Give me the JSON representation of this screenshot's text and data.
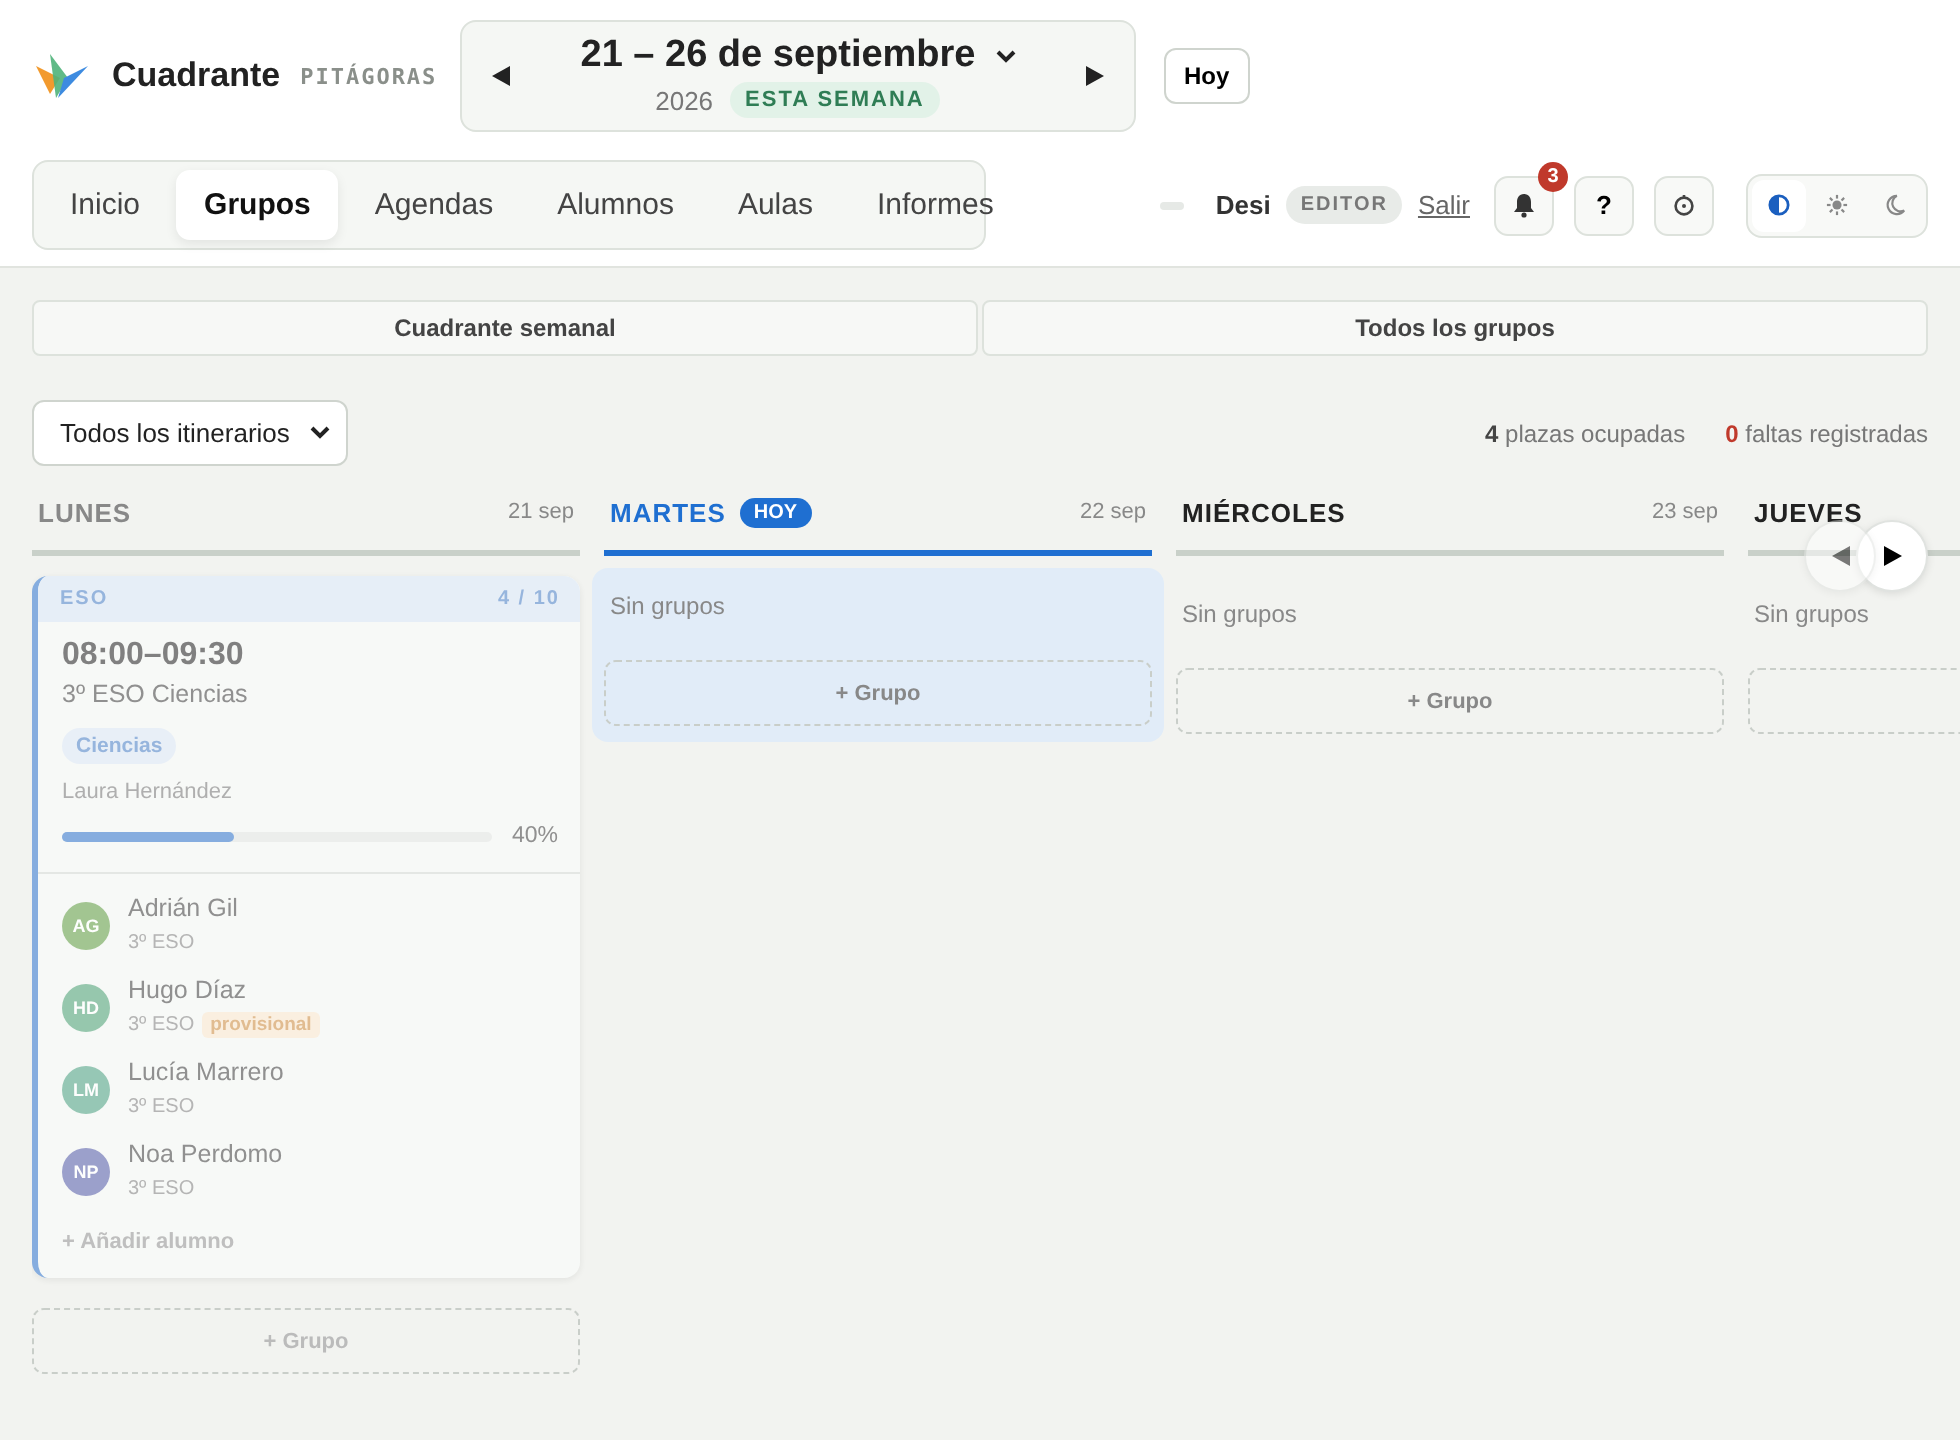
{
  "brand": {
    "name": "Cuadrante",
    "subtitle": "PITÁGORAS"
  },
  "week": {
    "range": "21 – 26 de septiembre",
    "year": "2026",
    "badge": "ESTA SEMANA"
  },
  "today_button": "Hoy",
  "nav_tabs": [
    {
      "label": "Inicio",
      "selected": false
    },
    {
      "label": "Grupos",
      "selected": true
    },
    {
      "label": "Agendas",
      "selected": false
    },
    {
      "label": "Alumnos",
      "selected": false
    },
    {
      "label": "Aulas",
      "selected": false
    },
    {
      "label": "Informes",
      "selected": false
    }
  ],
  "user": {
    "name": "Desi",
    "role": "EDITOR",
    "logout": "Salir"
  },
  "notifications": {
    "count": "3"
  },
  "help": "?",
  "theme_options": [
    {
      "kind": "auto",
      "selected": true
    },
    {
      "kind": "light",
      "selected": false
    },
    {
      "kind": "dark",
      "selected": false
    }
  ],
  "view_tabs": [
    "Cuadrante semanal",
    "Todos los grupos"
  ],
  "filter": {
    "value": "Todos los itinerarios"
  },
  "stats": [
    {
      "text": "**4** plazas ocupadas",
      "kind": "neutral"
    },
    {
      "text": "**0** faltas registradas",
      "kind": "alert"
    }
  ],
  "days": [
    {
      "name": "LUNES",
      "date": "21 sep",
      "today": false,
      "past": true,
      "add_label": "+ Grupo",
      "groups": [
        {
          "category": "ESO",
          "count": "4 / 10",
          "time": "08:00–09:30",
          "title": "3º ESO Ciencias",
          "tag": "Ciencias",
          "teacher": "Laura Hernández",
          "level": 0.4,
          "percent": "40%",
          "add_student": "+ Añadir alumno",
          "students": [
            {
              "initials": "AG",
              "name": "Adrián Gil",
              "course": "3º ESO",
              "color": "#9cc28a"
            },
            {
              "initials": "HD",
              "name": "Hugo Díaz",
              "course": "3º ESO",
              "tag": "provisional",
              "color": "#8fc4a8"
            },
            {
              "initials": "LM",
              "name": "Lucía Marrero",
              "course": "3º ESO",
              "color": "#8fc4b0"
            },
            {
              "initials": "NP",
              "name": "Noa Perdomo",
              "course": "3º ESO",
              "color": "#9499c8"
            }
          ]
        }
      ]
    },
    {
      "name": "MARTES",
      "badge": "HOY",
      "date": "22 sep",
      "today": true,
      "past": false,
      "empty_text": "Sin grupos",
      "add_label": "+ Grupo"
    },
    {
      "name": "MIÉRCOLES",
      "date": "23 sep",
      "today": false,
      "past": false,
      "empty_text": "Sin grupos",
      "add_label": "+ Grupo"
    },
    {
      "name": "JUEVES",
      "today": false,
      "past": false,
      "empty_text": "Sin grupos"
    }
  ],
  "carousel": {
    "prev_disabled": true
  }
}
